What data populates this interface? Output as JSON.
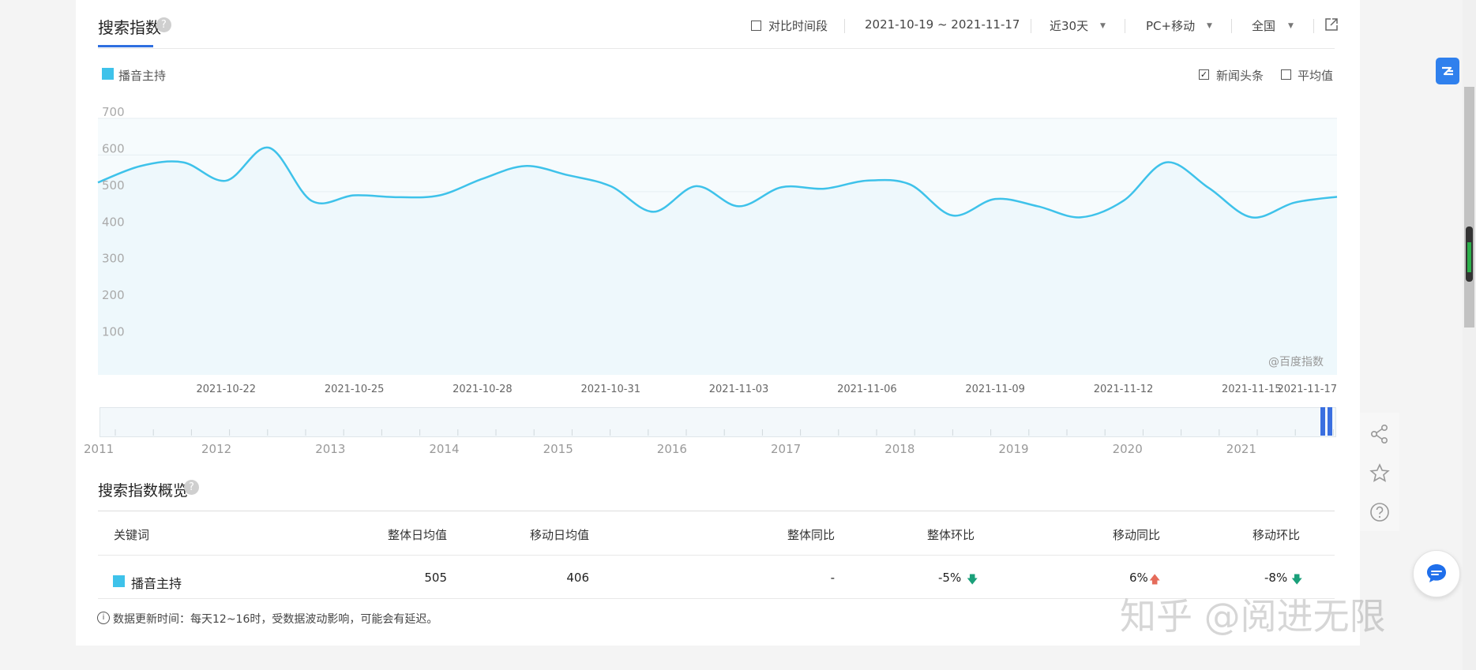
{
  "header": {
    "title": "搜索指数",
    "compare_label": "对比时间段",
    "date_range": "2021-10-19 ~ 2021-11-17",
    "period": "近30天",
    "device": "PC+移动",
    "region": "全国"
  },
  "legend": {
    "series_label": "播音主持",
    "news_label": "新闻头条",
    "avg_label": "平均值",
    "news_checked": "✓"
  },
  "watermark_chart": "@百度指数",
  "chart_data": {
    "type": "area",
    "title": "",
    "xlabel": "",
    "ylabel": "",
    "ylim": [
      0,
      700
    ],
    "yticks": [
      100,
      200,
      300,
      400,
      500,
      600,
      700
    ],
    "x_tick_labels": [
      "2021-10-22",
      "2021-10-25",
      "2021-10-28",
      "2021-10-31",
      "2021-11-03",
      "2021-11-06",
      "2021-11-09",
      "2021-11-12",
      "2021-11-15",
      "2021-11-17"
    ],
    "color": "#3ec2ea",
    "fill": "#eef8fc",
    "series": [
      {
        "name": "播音主持",
        "x": [
          "2021-10-19",
          "2021-10-20",
          "2021-10-21",
          "2021-10-22",
          "2021-10-23",
          "2021-10-24",
          "2021-10-25",
          "2021-10-26",
          "2021-10-27",
          "2021-10-28",
          "2021-10-29",
          "2021-10-30",
          "2021-10-31",
          "2021-11-01",
          "2021-11-02",
          "2021-11-03",
          "2021-11-04",
          "2021-11-05",
          "2021-11-06",
          "2021-11-07",
          "2021-11-08",
          "2021-11-09",
          "2021-11-10",
          "2021-11-11",
          "2021-11-12",
          "2021-11-13",
          "2021-11-14",
          "2021-11-15",
          "2021-11-16",
          "2021-11-17"
        ],
        "values": [
          525,
          570,
          580,
          530,
          620,
          475,
          490,
          485,
          490,
          535,
          570,
          545,
          515,
          445,
          515,
          460,
          512,
          508,
          530,
          520,
          435,
          480,
          460,
          430,
          475,
          580,
          510,
          430,
          470,
          486
        ]
      }
    ]
  },
  "timeline": {
    "years": [
      "2011",
      "2012",
      "2013",
      "2014",
      "2015",
      "2016",
      "2017",
      "2018",
      "2019",
      "2020",
      "2021"
    ]
  },
  "overview": {
    "title": "搜索指数概览",
    "headers": [
      "关键词",
      "整体日均值",
      "移动日均值",
      "整体同比",
      "整体环比",
      "移动同比",
      "移动环比"
    ],
    "row": {
      "keyword": "播音主持",
      "overall_avg": "505",
      "mobile_avg": "406",
      "overall_yoy": "-",
      "overall_mom": "-5%",
      "mobile_yoy": "6%",
      "mobile_mom": "-8%"
    },
    "note": "数据更新时间：每天12~16时，受数据波动影响，可能会有延迟。"
  },
  "page_watermark": "知乎 @阅进无限",
  "icons": {
    "help": "?",
    "info": "i",
    "arrow_down": "🡇",
    "arrow_up": "🡅",
    "caret": "▼"
  }
}
